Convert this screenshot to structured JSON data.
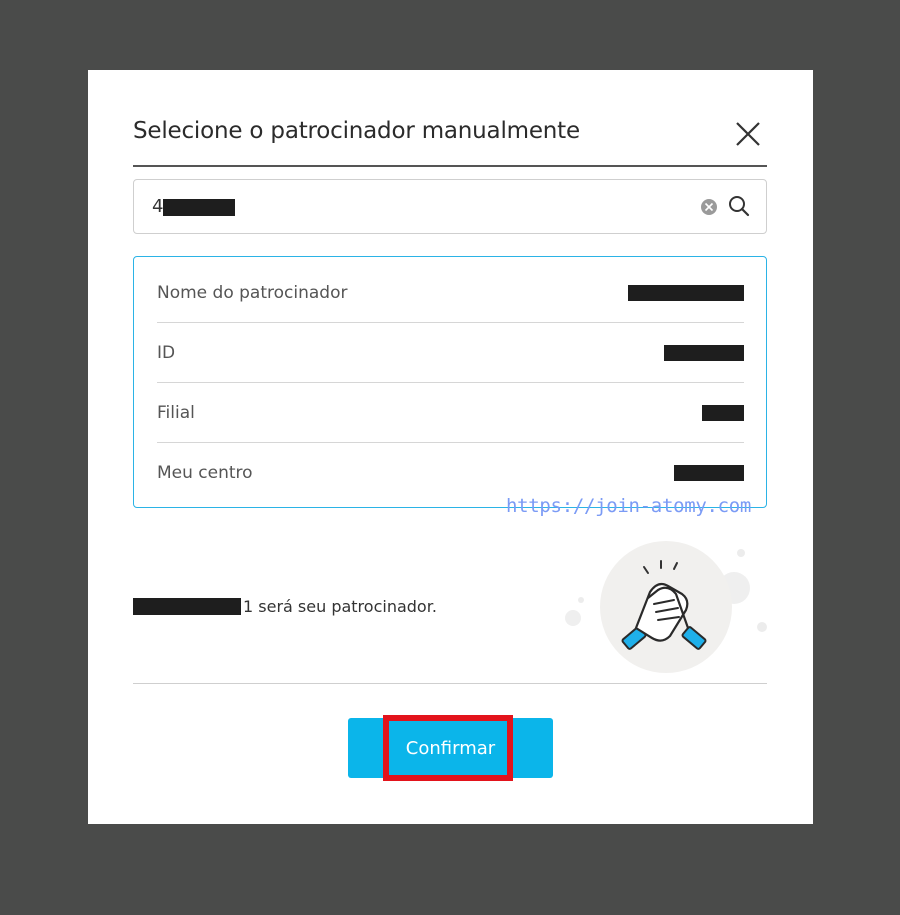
{
  "dialog": {
    "title": "Selecione o patrocinador manualmente"
  },
  "search": {
    "value_prefix": "4"
  },
  "sponsor_info": {
    "rows": [
      {
        "label": "Nome do patrocinador"
      },
      {
        "label": "ID"
      },
      {
        "label": "Filial"
      },
      {
        "label": "Meu centro"
      }
    ]
  },
  "watermark": "https://join-atomy.com",
  "message": {
    "suffix": "1 será seu patrocinador."
  },
  "confirm": {
    "label": "Confirmar"
  },
  "icons": {
    "close": "close-icon",
    "clear": "clear-icon",
    "search": "search-icon",
    "handshake": "handshake-icon"
  },
  "colors": {
    "accent": "#0bb5ea",
    "info_border": "#2bb3e6",
    "highlight": "#e3131b",
    "backdrop": "#4a4b4a"
  }
}
